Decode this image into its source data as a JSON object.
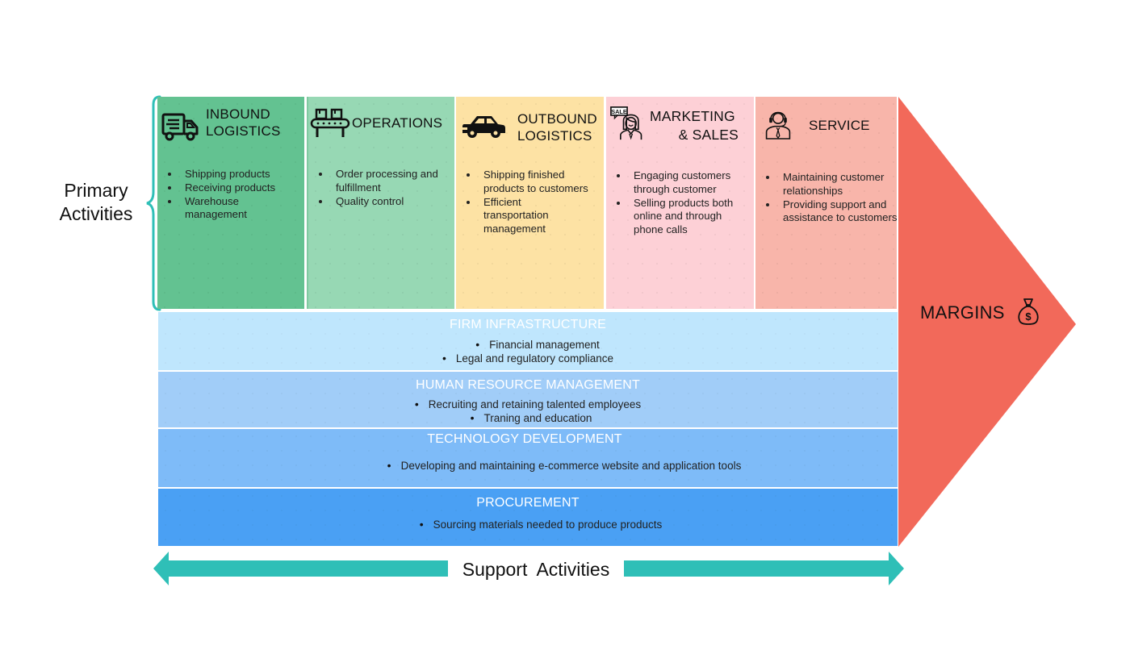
{
  "diagram": {
    "type": "value-chain",
    "primary_activities_label": [
      "Primary",
      "Activities"
    ],
    "support_activities_label": "Support  Activities",
    "margins_label": "MARGINS",
    "margins_icon": "money-bag-icon",
    "colors": {
      "inbound": "#63c291",
      "operations": "#97d8b4",
      "outbound": "#fde2a4",
      "marketing": "#fdd0d6",
      "service": "#f8b5aa",
      "margins": "#f2695a",
      "firm_infrastructure": "#bfe6fd",
      "human_resource": "#a1cdf8",
      "technology": "#7ebbf8",
      "procurement": "#4aa0f4",
      "support_arrow": "#2fbfb7",
      "brace": "#2fbfb7"
    }
  },
  "primary": [
    {
      "id": "inbound",
      "icon": "delivery-truck-icon",
      "title_lines": [
        "INBOUND",
        "LOGISTICS"
      ],
      "items": [
        "Shipping products",
        "Receiving products",
        "Warehouse management"
      ]
    },
    {
      "id": "operations",
      "icon": "conveyor-belt-icon",
      "title_lines": [
        "OPERATIONS"
      ],
      "items": [
        "Order processing and fulfillment",
        "Quality control"
      ]
    },
    {
      "id": "outbound",
      "icon": "car-icon",
      "title_lines": [
        "OUTBOUND",
        "LOGISTICS"
      ],
      "items": [
        "Shipping finished products to customers",
        "Efficient transportation management"
      ]
    },
    {
      "id": "marketing",
      "icon": "saleswoman-icon",
      "icon_badge": "SALE",
      "title_lines": [
        "MARKETING",
        "& SALES"
      ],
      "items": [
        "Engaging customers through customer",
        "Selling products both online and through phone calls"
      ]
    },
    {
      "id": "service",
      "icon": "customer-support-headset-icon",
      "title_lines": [
        "SERVICE"
      ],
      "items": [
        "Maintaining customer relationships",
        "Providing support and assistance to customers"
      ]
    }
  ],
  "support": [
    {
      "id": "firm",
      "title": "FIRM INFRASTRUCTURE",
      "items": [
        "Financial management",
        "Legal and regulatory compliance"
      ]
    },
    {
      "id": "hr",
      "title": "HUMAN RESOURCE MANAGEMENT",
      "items": [
        "Recruiting and retaining talented employees",
        "Traning and education"
      ]
    },
    {
      "id": "tech",
      "title": "TECHNOLOGY DEVELOPMENT",
      "items": [
        "Developing and maintaining e-commerce website and application tools"
      ]
    },
    {
      "id": "proc",
      "title": "PROCUREMENT",
      "items": [
        "Sourcing materials needed to produce products"
      ]
    }
  ]
}
